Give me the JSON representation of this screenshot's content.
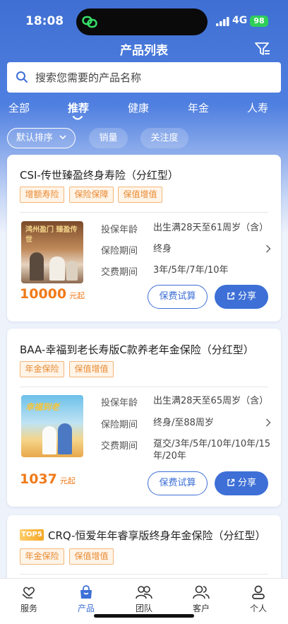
{
  "status_bar": {
    "time": "18:08",
    "network": "4G",
    "battery": "98"
  },
  "header": {
    "title": "产品列表"
  },
  "search": {
    "placeholder": "搜索您需要的产品名称"
  },
  "tabs": [
    {
      "label": "全部",
      "active": false
    },
    {
      "label": "推荐",
      "active": true
    },
    {
      "label": "健康",
      "active": false
    },
    {
      "label": "年金",
      "active": false
    },
    {
      "label": "人寿",
      "active": false
    }
  ],
  "sort_chips": [
    {
      "label": "默认排序"
    },
    {
      "label": "销量"
    },
    {
      "label": "关注度"
    }
  ],
  "products": [
    {
      "title": "CSI-传世臻盈终身寿险（分红型）",
      "tags": [
        "增额寿险",
        "保险保障",
        "保值增值"
      ],
      "thumb_text": "鸿州盈门 臻盈传世",
      "labels": {
        "age": "投保年龄",
        "period": "保险期间",
        "payment": "交费期间"
      },
      "age": "出生满28天至61周岁（含）",
      "period": "终身",
      "payment": "3年/5年/7年/10年",
      "price": "10000",
      "price_unit": "元起",
      "trial_label": "保费试算",
      "share_label": "分享"
    },
    {
      "title": "BAA-幸福到老长寿版C款养老年金保险（分红型）",
      "tags": [
        "年金保险",
        "保值增值"
      ],
      "thumb_text": "幸福到老",
      "labels": {
        "age": "投保年龄",
        "period": "保险期间",
        "payment": "交费期间"
      },
      "age": "出生满28天至65周岁（含）",
      "period": "终身/至88周岁",
      "payment_line1": "趸交/3年/5年/10年/10年/15",
      "payment_line2": "年/20年",
      "price": "1037",
      "price_unit": "元起",
      "trial_label": "保费试算",
      "share_label": "分享"
    },
    {
      "badge": "TOP5",
      "title": "CRQ-恒爱年年睿享版终身年金保险（分红型）",
      "tags": [
        "年金保险",
        "保值增值"
      ]
    }
  ],
  "tabbar": [
    {
      "label": "服务",
      "icon": "heart-hands-icon",
      "active": false
    },
    {
      "label": "产品",
      "icon": "bag-icon",
      "active": true
    },
    {
      "label": "团队",
      "icon": "team-icon",
      "active": false
    },
    {
      "label": "客户",
      "icon": "customer-icon",
      "active": false
    },
    {
      "label": "个人",
      "icon": "person-icon",
      "active": false
    }
  ],
  "colors": {
    "primary": "#3d6fd6",
    "price": "#f07a1a",
    "tag": "#e88930"
  }
}
